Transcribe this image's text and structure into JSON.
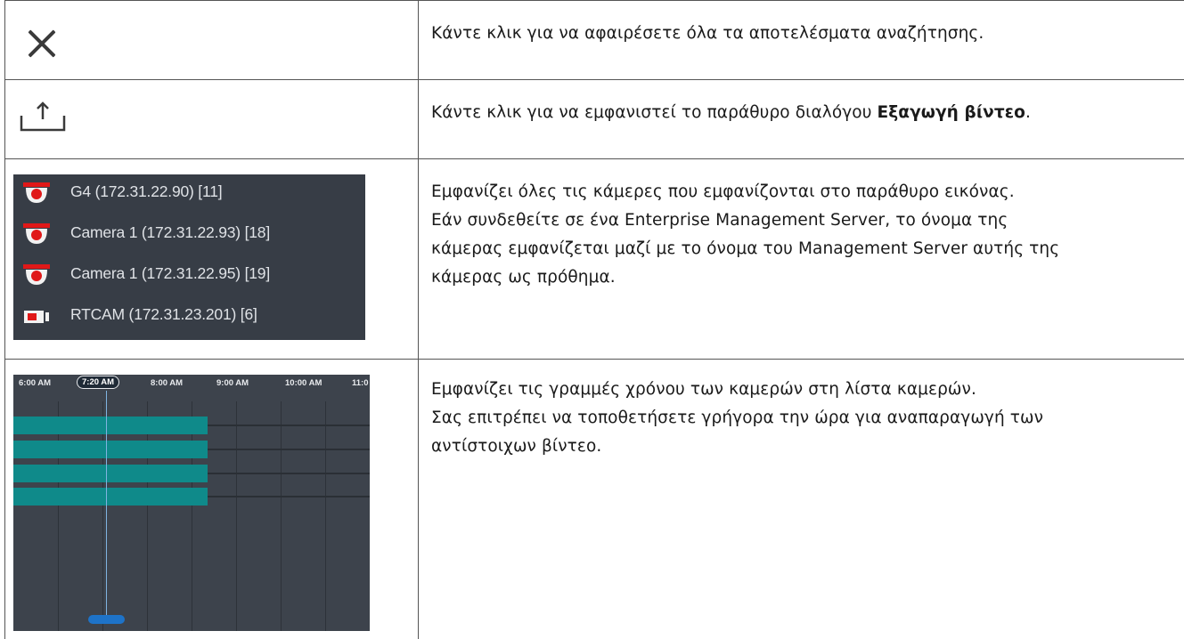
{
  "rows": [
    {
      "icon": "close-icon",
      "description": "Κάντε κλικ για να αφαιρέσετε όλα τα αποτελέσματα αναζήτησης."
    },
    {
      "icon": "export-icon",
      "description_prefix": "Κάντε κλικ για να εμφανιστεί το παράθυρο διαλόγου ",
      "description_bold": "Εξαγωγή βίντεο",
      "description_suffix": "."
    },
    {
      "camera_list": [
        {
          "icon": "dome-camera-icon",
          "label": "G4 (172.31.22.90) [11]"
        },
        {
          "icon": "dome-camera-icon",
          "label": "Camera 1 (172.31.22.93) [18]"
        },
        {
          "icon": "dome-camera-icon",
          "label": "Camera 1 (172.31.22.95) [19]"
        },
        {
          "icon": "box-camera-icon",
          "label": "RTCAM (172.31.23.201) [6]"
        }
      ],
      "description_lines": [
        "Εμφανίζει όλες τις κάμερες που εμφανίζονται στο παράθυρο εικόνας.",
        "Εάν συνδεθείτε σε ένα Enterprise Management Server, το όνομα της",
        "κάμερας εμφανίζεται μαζί με το όνομα του Management Server αυτής της",
        "κάμερας ως πρόθημα."
      ]
    },
    {
      "timeline": {
        "ticks": [
          "6:00 AM",
          "8:00 AM",
          "9:00 AM",
          "10:00 AM",
          "11:0"
        ],
        "current_time": "7:20 AM",
        "track_count": 4
      },
      "description_lines": [
        "Εμφανίζει τις γραμμές χρόνου των καμερών στη λίστα καμερών.",
        "Σας επιτρέπει να τοποθετήσετε γρήγορα την ώρα για αναπαραγωγή των",
        "αντίστοιχων βίντεο."
      ]
    }
  ],
  "colors": {
    "panel_bg": "#373d46",
    "timeline_bg": "#3d434c",
    "recording_bar": "#0f8a8a",
    "camera_red": "#e01818",
    "handle_blue": "#1e73c8"
  }
}
